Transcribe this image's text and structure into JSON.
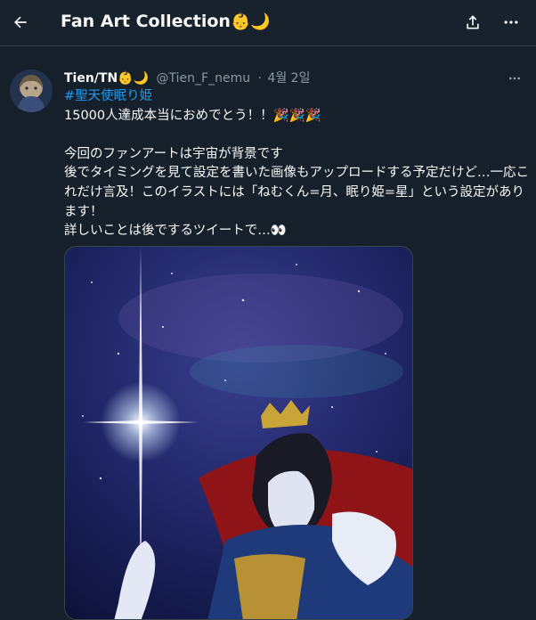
{
  "header": {
    "title": "Fan Art Collection",
    "title_emoji": "👶🌙",
    "back_icon": "arrow-left-icon",
    "share_icon": "share-icon",
    "more_icon": "more-horizontal-icon"
  },
  "tweet": {
    "display_name": "Tien/TN",
    "name_emoji": "👶🌙",
    "handle": "@Tien_F_nemu",
    "separator": "·",
    "date": "4월 2일",
    "hashtag": "#聖天使眠り姫",
    "lines": [
      "15000人達成本当におめでとう！！🎉🎉🎉",
      "今回のファンアートは宇宙が背景です",
      "後でタイミングを見て設定を書いた画像もアップロードする予定だけど…一応これだけ言及！このイラストには「ねむくん=月、眠り姫=星」という設定があります！",
      "詳しいことは後でするツイートで…👀"
    ],
    "media_description": "fan art illustration"
  },
  "colors": {
    "background": "#15202b",
    "text": "#f7f9f9",
    "secondary": "#8b98a5",
    "accent": "#1d9bf0"
  }
}
